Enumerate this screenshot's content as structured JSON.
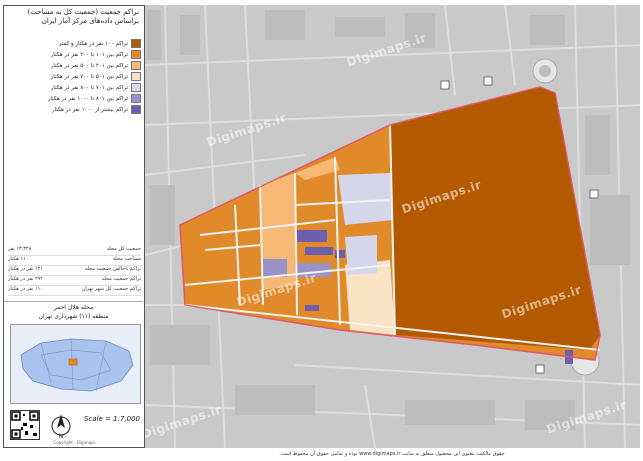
{
  "title_lines": [
    "نراکم جمعیت (جمعیت کل به مساحت)",
    "براساس داده‌های مرکز آمار ایران"
  ],
  "legend": [
    {
      "label": "تراکم ۱۰۰ نفر در هکتار و کمتر",
      "color": "#b35a00"
    },
    {
      "label": "تراکم بین ۱۰۱ تا ۲۰۰ نفر در هکتار",
      "color": "#e08a2a"
    },
    {
      "label": "تراکم بین ۲۰۱ تا ۵۰۰ نفر در هکتار",
      "color": "#f6b975"
    },
    {
      "label": "تراکم بین ۵۰۱ تا ۷۰۰ نفر در هکتار",
      "color": "#fbe3c6"
    },
    {
      "label": "تراکم بین ۷۰۱ تا ۸۰۰ نفر در هکتار",
      "color": "#d6d6ea"
    },
    {
      "label": "تراکم بین ۸۰۱ تا ۱۰۰۰ نفر در هکتار",
      "color": "#9a93c8"
    },
    {
      "label": "تراکم بیشتر از ۱۰۰۰ نفر در هکتار",
      "color": "#6c5fad"
    }
  ],
  "stats": [
    {
      "label": "جمعیت کل محله",
      "value": "۱۳,۳۲۸ نفر"
    },
    {
      "label": "مساحت محله",
      "value": "۱۱۰ هکتار"
    },
    {
      "label": "تراکم ناخالص جمعیت محله",
      "value": "۱۲۱ نفر در هکتار"
    },
    {
      "label": "تراکم جمعیت محله",
      "value": "۲۹۲ نفر در هکتار"
    },
    {
      "label": "تراکم جمعیت کل شهر تهران",
      "value": "۱۱۰ نفر در هکتار"
    }
  ],
  "area_name": "محله هلال احمر",
  "district": "منطقه (۱۱) شهرداری تهران",
  "scale": "Scale = 1:7,000",
  "north_label": "N",
  "panel_footer": "Copyright - Digimaps",
  "footer_note": "حقوق مالکیت معنوی این محصول متعلق به سایت www.digimaps.ir بوده و تمامی حقوق آن محفوظ است.",
  "watermark": "Digimaps.ir",
  "colors": {
    "background_map": "#c9c9c9",
    "street": "#e6e6e6",
    "boundary": "#e05a6a"
  }
}
